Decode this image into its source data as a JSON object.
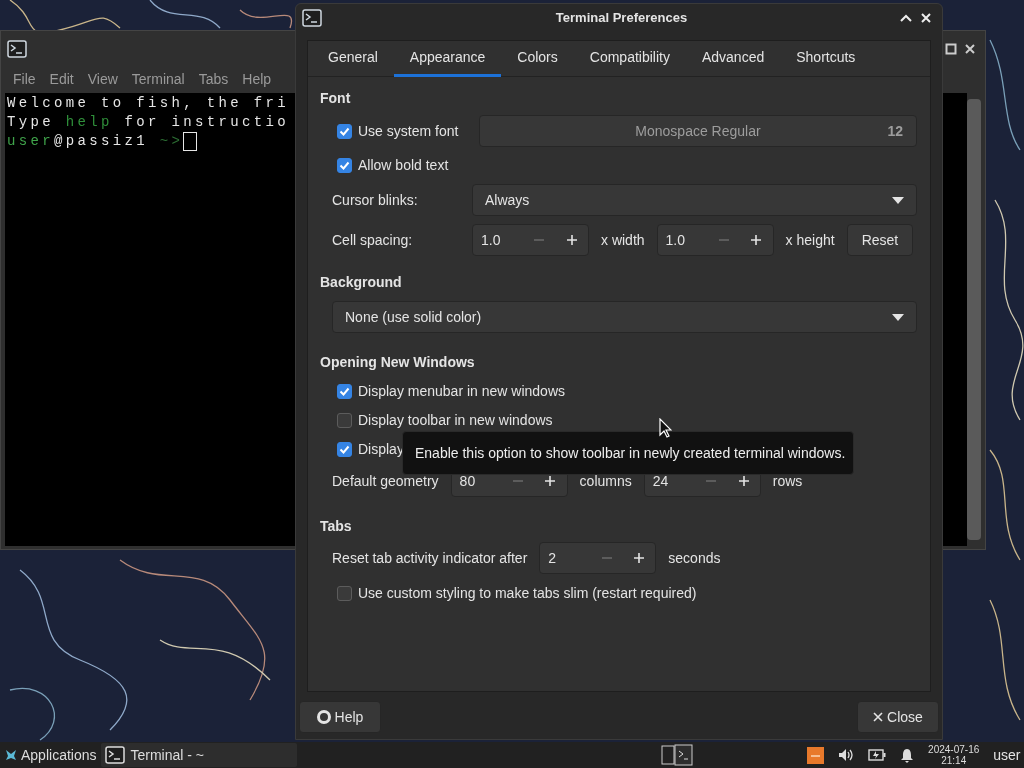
{
  "terminal_window": {
    "menu": [
      "File",
      "Edit",
      "View",
      "Terminal",
      "Tabs",
      "Help"
    ],
    "lines": [
      [
        {
          "text": "Welcome to fish, the fri",
          "color": "#e6e6e6"
        }
      ],
      [
        {
          "text": "Type ",
          "color": "#e6e6e6"
        },
        {
          "text": "help",
          "color": "#2f8f3a"
        },
        {
          "text": " for instructio",
          "color": "#e6e6e6"
        }
      ],
      [
        {
          "text": "user",
          "color": "#3fa34a"
        },
        {
          "text": "@passiz1 ",
          "color": "#e6e6e6"
        },
        {
          "text": "~>",
          "color": "#2c6e33"
        }
      ]
    ]
  },
  "preferences": {
    "title": "Terminal Preferences",
    "tabs": [
      {
        "label": "General",
        "selected": false
      },
      {
        "label": "Appearance",
        "selected": true
      },
      {
        "label": "Colors",
        "selected": false
      },
      {
        "label": "Compatibility",
        "selected": false
      },
      {
        "label": "Advanced",
        "selected": false
      },
      {
        "label": "Shortcuts",
        "selected": false
      }
    ],
    "sections": [
      {
        "heading": "Font",
        "rows": [
          {
            "kind": "checkbox",
            "label": "Use system font",
            "checked": true,
            "font": {
              "name": "Monospace Regular",
              "size": "12"
            }
          },
          {
            "kind": "checkbox",
            "label": "Allow bold text",
            "checked": true
          },
          {
            "kind": "select",
            "label": "Cursor blinks:",
            "value": "Always"
          },
          {
            "kind": "spacing",
            "label": "Cell spacing:",
            "fields": [
              {
                "value": "1.0",
                "unit": "x width"
              },
              {
                "value": "1.0",
                "unit": "x height"
              }
            ],
            "button": "Reset"
          }
        ]
      },
      {
        "heading": "Background",
        "rows": [
          {
            "kind": "select",
            "value": "None (use solid color)"
          }
        ]
      },
      {
        "heading": "Opening New Windows",
        "rows": [
          {
            "kind": "checkbox",
            "label": "Display menubar in new windows",
            "checked": true
          },
          {
            "kind": "checkbox",
            "label": "Display toolbar in new windows",
            "checked": false
          },
          {
            "kind": "checkbox",
            "label": "Display",
            "checked": true
          },
          {
            "kind": "spins",
            "label": "Default geometry",
            "fields": [
              {
                "value": "80",
                "unit": "columns"
              },
              {
                "value": "24",
                "unit": "rows"
              }
            ]
          }
        ]
      },
      {
        "heading": "Tabs",
        "rows": [
          {
            "kind": "spins",
            "label": "Reset tab activity indicator after",
            "fields": [
              {
                "value": "2",
                "unit": "seconds"
              }
            ]
          },
          {
            "kind": "checkbox",
            "label": "Use custom styling to make tabs slim (restart required)",
            "checked": false
          }
        ]
      }
    ],
    "tooltip": "Enable this option to show toolbar in newly created terminal windows.",
    "buttons": [
      {
        "kind": "help",
        "label": "Help"
      },
      {
        "kind": "close",
        "label": "Close"
      }
    ]
  },
  "taskbar": {
    "menu": "Applications",
    "task": "Terminal - ~",
    "date": "2024-07-16",
    "time": "21:14",
    "user": "user"
  }
}
